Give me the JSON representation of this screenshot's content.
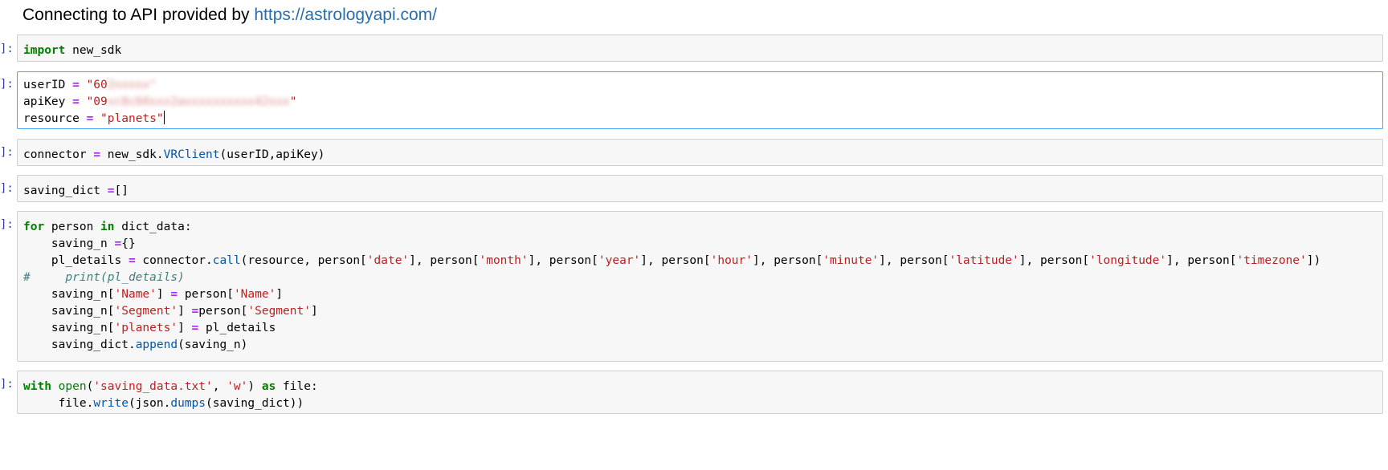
{
  "heading": {
    "text": "Connecting to API provided by ",
    "link": "https://astrologyapi.com/"
  },
  "prompt_symbol": "]:",
  "cells": {
    "c1": {
      "kw_import": "import",
      "module": " new_sdk"
    },
    "c2": {
      "user_var": "userID ",
      "user_eq": "=",
      "user_str": " \"60",
      "user_redacted": "2xxxxx\"",
      "api_var": "apiKey ",
      "api_eq": "=",
      "api_str": " \"09",
      "api_redacted": "xc8c60xxx2axxxxxxxxxx42xxx",
      "api_end": "\"",
      "res_var": "resource ",
      "res_eq": "=",
      "res_str": " \"planets\""
    },
    "c3": {
      "lhs": "connector ",
      "eq": "=",
      "obj": " new_sdk.",
      "call": "VRClient",
      "args": "(userID,apiKey)"
    },
    "c4": {
      "lhs": "saving_dict ",
      "eq": "=",
      "rhs": "[]"
    },
    "c5": {
      "l1_for": "for",
      "l1_a": " person ",
      "l1_in": "in",
      "l1_b": " dict_data:",
      "l2_a": "    saving_n ",
      "l2_eq": "=",
      "l2_b": "{}",
      "l3_a": "    pl_details ",
      "l3_eq": "=",
      "l3_b": " connector.",
      "l3_call": "call",
      "l3_c": "(resource, person[",
      "l3_s1": "'date'",
      "l3_d": "], person[",
      "l3_s2": "'month'",
      "l3_e": "], person[",
      "l3_s3": "'year'",
      "l3_f": "], person[",
      "l3_s4": "'hour'",
      "l3_g": "], person[",
      "l3_s5": "'minute'",
      "l3_h": "], person[",
      "l3_s6": "'latitude'",
      "l3_i": "], person[",
      "l3_s7": "'longitude'",
      "l3_j": "], person[",
      "l3_s8": "'timezone'",
      "l3_k": "])",
      "l4_comment": "#     print(pl_details)",
      "l5_a": "    saving_n[",
      "l5_s": "'Name'",
      "l5_b": "] ",
      "l5_eq": "=",
      "l5_c": " person[",
      "l5_s2": "'Name'",
      "l5_d": "]",
      "l6_a": "    saving_n[",
      "l6_s": "'Segment'",
      "l6_b": "] ",
      "l6_eq": "=",
      "l6_c": "person[",
      "l6_s2": "'Segment'",
      "l6_d": "]",
      "l7_a": "    saving_n[",
      "l7_s": "'planets'",
      "l7_b": "] ",
      "l7_eq": "=",
      "l7_c": " pl_details",
      "l8_a": "    saving_dict.",
      "l8_call": "append",
      "l8_b": "(saving_n)"
    },
    "c6": {
      "l1_with": "with",
      "l1_sp": " ",
      "l1_open": "open",
      "l1_a": "(",
      "l1_s1": "'saving_data.txt'",
      "l1_b": ", ",
      "l1_s2": "'w'",
      "l1_c": ") ",
      "l1_as": "as",
      "l1_d": " file:",
      "l2_a": "     file.",
      "l2_write": "write",
      "l2_b": "(json.",
      "l2_dumps": "dumps",
      "l2_c": "(saving_dict))"
    }
  }
}
